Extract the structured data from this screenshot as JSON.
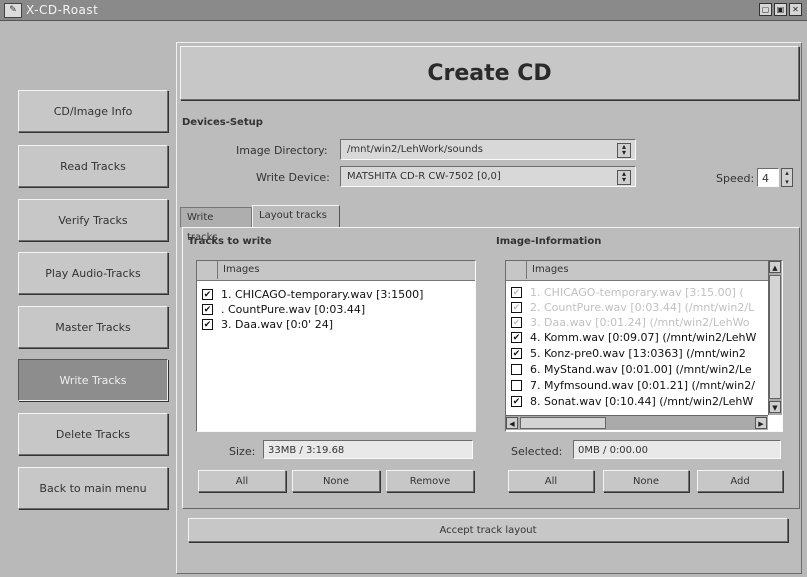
{
  "window": {
    "title": "X-CD-Roast",
    "icon_label": "✎",
    "controls": [
      "▢",
      "▣",
      "✕"
    ]
  },
  "nav": [
    {
      "label": "CD/Image Info",
      "active": false
    },
    {
      "label": "Read Tracks",
      "active": false
    },
    {
      "label": "Verify Tracks",
      "active": false
    },
    {
      "label": "Play Audio-Tracks",
      "active": false
    },
    {
      "label": "Master Tracks",
      "active": false
    },
    {
      "label": "Write Tracks",
      "active": true
    },
    {
      "label": "Delete Tracks",
      "active": false
    },
    {
      "label": "Back to main menu",
      "active": false
    }
  ],
  "heading": "Create CD",
  "devices": {
    "title": "Devices-Setup",
    "image_dir_label": "Image Directory:",
    "image_dir_value": "/mnt/win2/LehWork/sounds",
    "write_device_label": "Write Device:",
    "write_device_value": "MATSHITA CD-R   CW-7502   [0,0]",
    "speed_label": "Speed:",
    "speed_value": "4"
  },
  "tabs": [
    {
      "label": "Write tracks",
      "active": false
    },
    {
      "label": "Layout tracks",
      "active": true
    }
  ],
  "left": {
    "title": "Tracks to write",
    "column": "Images",
    "rows": [
      {
        "text": "1. CHICAGO-temporary.wav [3:1500]",
        "checked": true
      },
      {
        "text": ". CountPure.wav [0:03.44]",
        "checked": true
      },
      {
        "text": "3. Daa.wav [0:0' 24]",
        "checked": true
      }
    ],
    "size_label": "Size:",
    "size_value": "33MB / 3:19.68",
    "buttons": [
      "All",
      "None",
      "Remove"
    ]
  },
  "right": {
    "title": "Image-Information",
    "column": "Images",
    "rows": [
      {
        "text": "1. CHICAGO-temporary.wav [3:15.00] (",
        "checked": true,
        "faded": true
      },
      {
        "text": "2. CountPure.wav [0:03.44] (/mnt/win2/L",
        "checked": true,
        "faded": true
      },
      {
        "text": "3. Daa.wav [0:01.24] (/mnt/win2/LehWo",
        "checked": true,
        "faded": true
      },
      {
        "text": "4. Komm.wav [0:09.07] (/mnt/win2/LehW",
        "checked": true,
        "faded": false
      },
      {
        "text": "5. Konz-pre0.wav [13:0363] (/mnt/win2",
        "checked": true,
        "faded": false
      },
      {
        "text": "6. MyStand.wav [0:01.00] (/mnt/win2/Le",
        "checked": false,
        "faded": false
      },
      {
        "text": "7. Myfmsound.wav [0:01.21] (/mnt/win2/",
        "checked": false,
        "faded": false
      },
      {
        "text": "8. Sonat.wav [0:10.44] (/mnt/win2/LehW",
        "checked": true,
        "faded": false
      }
    ],
    "selected_label": "Selected:",
    "selected_value": "0MB / 0:00.00",
    "buttons": [
      "All",
      "None",
      "Add"
    ]
  },
  "accept_label": "Accept track layout",
  "icons": {
    "check": "✔",
    "up": "▲",
    "down": "▼",
    "left": "◀",
    "right": "▶"
  }
}
